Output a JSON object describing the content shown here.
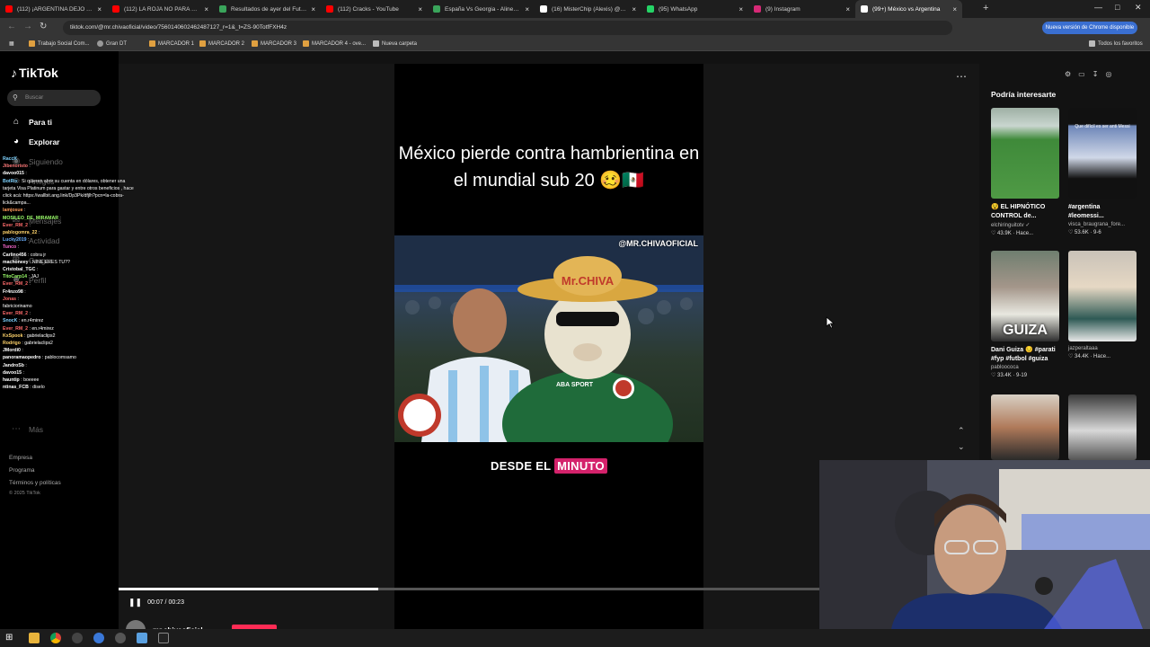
{
  "browser": {
    "tabs": [
      {
        "title": "(112) ¡ARGENTINA DEJÓ AFUE",
        "color": "#ff0000"
      },
      {
        "title": "(112) LA ROJA NO PARA DE GA",
        "color": "#ff0000"
      },
      {
        "title": "Resultados de ayer del Futbol A",
        "color": "#3aa55b"
      },
      {
        "title": "(112) Cracks - YouTube",
        "color": "#ff0000"
      },
      {
        "title": "España Vs Georgia - Alineacion",
        "color": "#3aa55b"
      },
      {
        "title": "(16) MisterChip (Alexis) @2010",
        "color": "#ffffff"
      },
      {
        "title": "(95) WhatsApp",
        "color": "#25d366"
      },
      {
        "title": "(9) Instagram",
        "color": "#d62976"
      },
      {
        "title": "(99+) México vs Argentina",
        "color": "#ffffff",
        "active": true
      }
    ],
    "url": "tiktok.com/@mr.chivaoficial/video/7560140602462487127_r=1&_t=ZS-90TotfFXH4z",
    "update_label": "Nueva versión de Chrome disponible",
    "bookmarks": [
      "Trabajo Social Com...",
      "Gran DT",
      "MARCADOR 1",
      "MARCADOR 2",
      "MARCADOR 3",
      "MARCADOR 4 - ove...",
      "Nueva carpeta"
    ],
    "all_favorites": "Todos los favoritos"
  },
  "tiktok": {
    "logo": "TikTok",
    "search_placeholder": "Buscar",
    "nav": [
      "Para ti",
      "Explorar",
      "Siguiendo",
      "Amigos",
      "Mensajes",
      "Actividad",
      "Cargar",
      "Perfil",
      "Más"
    ],
    "footer": [
      "Empresa",
      "Programa",
      "Términos y políticas",
      "© 2025 TikTok"
    ],
    "video": {
      "caption": "México pierde contra hambrientina en el mundial sub 20 🥴🇲🇽",
      "watermark": "@MR.CHIVAOFICIAL",
      "hat_text": "Mr.CHIVA",
      "shirt_text": "ABA SPORT",
      "subtitle_pre": "DESDE EL",
      "subtitle_highlight": "MINUTO",
      "time": "00:07 / 00:23",
      "progress": 0.37,
      "author": "mr.chivaoficial"
    },
    "right_title": "Podría interesarte",
    "recs": [
      {
        "caption": "😵 EL HIPNÓTICO CONTROL de...",
        "user": "elchiringuitotv ✓",
        "likes": "♡ 43.9K · Hace...",
        "overlay": ""
      },
      {
        "caption": "#argentina #leomessi...",
        "user": "visca_braugrana_fore...",
        "likes": "♡ 53.6K · 9-6",
        "overlay": "Que difícil es ser anti Messi"
      },
      {
        "caption": "Dani Guiza 😔 #parati #fyp #futbol #guiza",
        "user": "pabloococa",
        "likes": "♡ 33.4K · 9-19",
        "overlay": "GUIZA"
      },
      {
        "caption": "",
        "user": "jazperaltaaa",
        "likes": "♡ 34.4K · Hace...",
        "overlay": ""
      },
      {
        "caption": "",
        "user": "",
        "likes": "",
        "overlay": ""
      },
      {
        "caption": "",
        "user": "",
        "likes": "",
        "overlay": ""
      }
    ]
  },
  "chat": [
    {
      "user": "RaccK",
      "msg": "",
      "color": "#7fd3ff"
    },
    {
      "user": "Jibenoristo",
      "msg": ":",
      "color": "#ff7a7a"
    },
    {
      "user": "davoo015",
      "msg": ":",
      "color": "#ffffff"
    },
    {
      "user": "BotRix",
      "msg": ": Si quieren abrir su cuenta en dólares, obtener una",
      "color": "#7fd3ff"
    },
    {
      "user": "",
      "msg": "tarjeta Visa Platinum para gastar y entre otros beneficios , hace",
      "color": "#ffffff"
    },
    {
      "user": "",
      "msg": "click acá: https://wallbit.ang.link/Dp3Pk/dfjlh?pcn=la-cobra-",
      "color": "#ffffff"
    },
    {
      "user": "",
      "msg": "lick&campa...",
      "color": "#ffffff"
    },
    {
      "user": "lamjosue",
      "msg": ":",
      "color": "#ff9b5a"
    },
    {
      "user": "MOSILEO_DE_MIRAMAR",
      "msg": ":",
      "color": "#9cff6b"
    },
    {
      "user": "Ever_RM_2",
      "msg": ":",
      "color": "#ff6b6b"
    },
    {
      "user": "pablogomra_22",
      "msg": ":",
      "color": "#ffd36b"
    },
    {
      "user": "Lucky2019",
      "msg": ":",
      "color": "#6bb0ff"
    },
    {
      "user": "Tunco",
      "msg": ":",
      "color": "#ff6bd3"
    },
    {
      "user": "Carlino456",
      "msg": ": cobra jr",
      "color": "#ffffff"
    },
    {
      "user": "machoneey",
      "msg": ": NINE ERES TU??",
      "color": "#ffffff"
    },
    {
      "user": "Cristobal_TGC",
      "msg": ":",
      "color": "#ffffff"
    },
    {
      "user": "TitoCarp14",
      "msg": ": JAJ",
      "color": "#9cff6b"
    },
    {
      "user": "Ever_RM_2",
      "msg": ":",
      "color": "#ff6b6b"
    },
    {
      "user": "Fr4nzo98",
      "msg": ":",
      "color": "#ffffff"
    },
    {
      "user": "Jonas",
      "msg": ":",
      "color": "#ff6b6b"
    },
    {
      "user": "",
      "msg": "fabriciorinamo",
      "color": "#ffffff"
    },
    {
      "user": "Ever_RM_2",
      "msg": ":",
      "color": "#ff6b6b"
    },
    {
      "user": "SnocK",
      "msg": ": en.r4mirez",
      "color": "#7fd3ff"
    },
    {
      "user": "Ever_RM_2",
      "msg": ": en.r4mirez",
      "color": "#ff6b6b"
    },
    {
      "user": "KxSpook",
      "msg": ": gabrielaclips2",
      "color": "#ffd36b"
    },
    {
      "user": "Rodrigo",
      "msg": ": gabrielaclips2",
      "color": "#ffd36b"
    },
    {
      "user": "JMordi0",
      "msg": ":",
      "color": "#ffffff"
    },
    {
      "user": "panoramaopedro",
      "msg": ": pablocomsamo",
      "color": "#ffffff"
    },
    {
      "user": "JandroSb",
      "msg": ":",
      "color": "#ffffff"
    },
    {
      "user": "davoo15",
      "msg": ":",
      "color": "#ffffff"
    },
    {
      "user": "hauntip",
      "msg": ": boeeee",
      "color": "#ffffff"
    },
    {
      "user": "ntinas_FCB",
      "msg": ": diselo",
      "color": "#ffffff"
    }
  ]
}
